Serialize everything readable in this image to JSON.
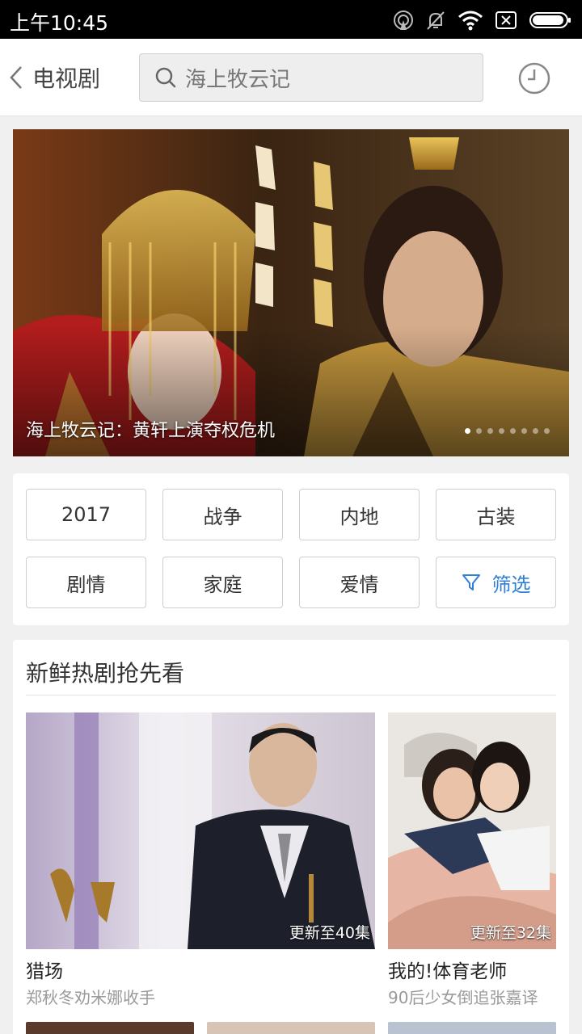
{
  "status_bar": {
    "time": "上午10:45",
    "icons": [
      "hotspot-icon",
      "mute-bell-icon",
      "wifi-icon",
      "sim-off-icon",
      "battery-icon"
    ]
  },
  "header": {
    "back_title": "电视剧",
    "search_placeholder": "海上牧云记",
    "history_icon": "clock-icon"
  },
  "banner": {
    "caption": "海上牧云记：黄轩上演夺权危机",
    "slide_count": 8,
    "active_slide": 1
  },
  "filters": {
    "tags": [
      "2017",
      "战争",
      "内地",
      "古装",
      "剧情",
      "家庭",
      "爱情"
    ],
    "filter_label": "筛选",
    "accent": "#2f7fd6"
  },
  "hot_section": {
    "title": "新鲜热剧抢先看",
    "shows": [
      {
        "name": "猎场",
        "episode": "更新至40集",
        "subtitle": "郑秋冬劝米娜收手"
      },
      {
        "name": "我的!体育老师",
        "episode": "更新至32集",
        "subtitle": "90后少女倒追张嘉译"
      }
    ]
  }
}
